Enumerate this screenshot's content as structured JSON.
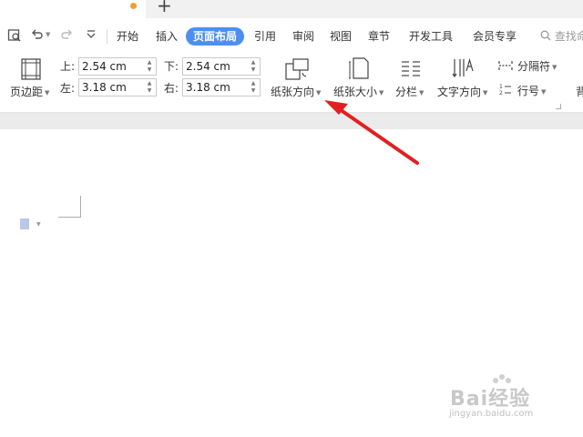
{
  "tabs": {
    "new_tab_symbol": "+"
  },
  "quick_access": {
    "icons": [
      "print-preview-icon",
      "undo-icon",
      "redo-icon",
      "customize-toolbar-icon"
    ]
  },
  "menu": {
    "items": [
      {
        "label": "开始"
      },
      {
        "label": "插入"
      },
      {
        "label": "页面布局",
        "active": true
      },
      {
        "label": "引用"
      },
      {
        "label": "审阅"
      },
      {
        "label": "视图"
      },
      {
        "label": "章节"
      },
      {
        "label": "开发工具"
      },
      {
        "label": "会员专享"
      }
    ],
    "search_placeholder": "查找命"
  },
  "ribbon": {
    "margins": {
      "label": "页边距"
    },
    "top": {
      "label": "上:",
      "value": "2.54 cm"
    },
    "bottom": {
      "label": "下:",
      "value": "2.54 cm"
    },
    "left": {
      "label": "左:",
      "value": "3.18 cm"
    },
    "right": {
      "label": "右:",
      "value": "3.18 cm"
    },
    "orientation": {
      "label": "纸张方向"
    },
    "size": {
      "label": "纸张大小"
    },
    "columns": {
      "label": "分栏"
    },
    "text_direction": {
      "label": "文字方向"
    },
    "breaks": {
      "label": "分隔符"
    },
    "line_numbers": {
      "label": "行号"
    },
    "background": {
      "label": "背"
    }
  },
  "colors": {
    "accent": "#4d8ff0",
    "arrow": "#e02020",
    "tab_dot": "#f0a030"
  },
  "watermark": {
    "brand": "Bai经验",
    "url": "jingyan.baidu.com"
  }
}
